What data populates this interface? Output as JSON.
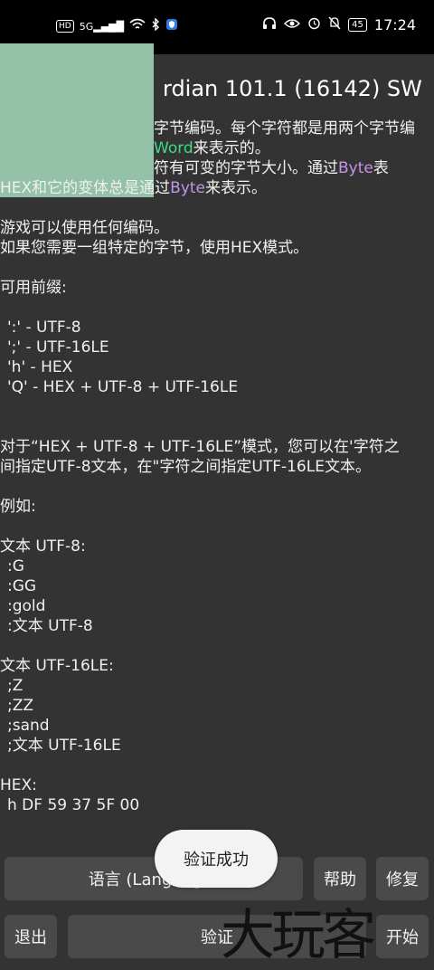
{
  "status_bar": {
    "hd_label": "HD",
    "signal_label": "5G",
    "battery_label": "45",
    "time": "17:24"
  },
  "header": {
    "title": "rdian 101.1 (16142) SW"
  },
  "help_text": {
    "line1": "字节编码。每个字符都是用两个字节编",
    "line2_word": "Word",
    "line2_suffix": "来表示的。",
    "line3_prefix": "符有可变的字节大小。通过",
    "line3_byte": "Byte",
    "line3_suffix": "表",
    "line4_prefix": "HEX和它的变体总是通过",
    "line4_byte": "Byte",
    "line4_suffix": "来表示。",
    "line5": "游戏可以使用任何编码。",
    "line6": "如果您需要一组特定的字节，使用HEX模式。",
    "line7": "可用前缀:",
    "prefix1": "':' - UTF-8",
    "prefix2": "';' - UTF-16LE",
    "prefix3": "'h' - HEX",
    "prefix4": "'Q' - HEX + UTF-8 + UTF-16LE",
    "para1": "对于“HEX + UTF-8 + UTF-16LE”模式，您可以在'字符之",
    "para2": "间指定UTF-8文本，在\"字符之间指定UTF-16LE文本。",
    "example": "例如:",
    "utf8_title": "文本 UTF-8:",
    "utf8_1": ":G",
    "utf8_2": ":GG",
    "utf8_3": ":gold",
    "utf8_4": ":文本 UTF-8",
    "utf16_title": "文本 UTF-16LE:",
    "utf16_1": ";Z",
    "utf16_2": ";ZZ",
    "utf16_3": ";sand",
    "utf16_4": ";文本 UTF-16LE",
    "hex_title": "HEX:",
    "hex_1": "h DF 59 37 5F 00"
  },
  "toast": {
    "message": "验证成功"
  },
  "buttons": {
    "language": "语言 (Language)",
    "help": "帮助",
    "repair": "修复",
    "exit": "退出",
    "verify": "验证",
    "open": "开始"
  },
  "watermark": {
    "text": "大玩客"
  },
  "colors": {
    "background": "#333333",
    "button": "#4a4a4a",
    "word_highlight": "#3ddc84",
    "byte_highlight": "#c792ea",
    "avatar": "#94c1a8"
  }
}
